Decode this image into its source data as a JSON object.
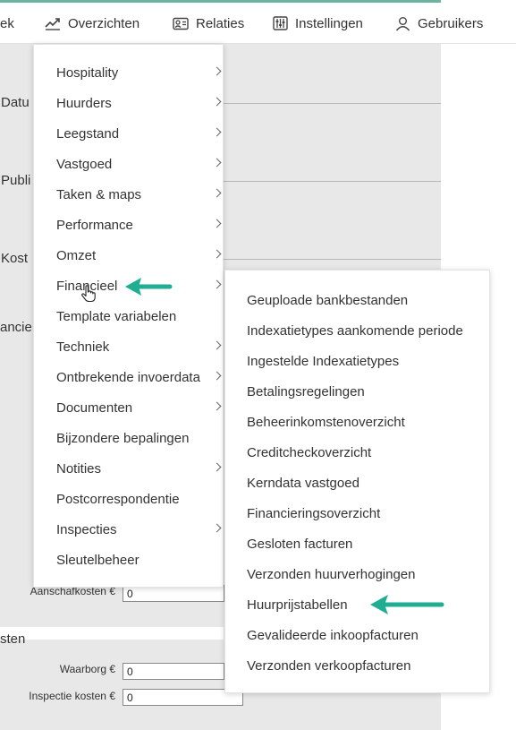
{
  "nav": {
    "items": [
      {
        "label": "ek",
        "icon": "book-icon"
      },
      {
        "label": "Overzichten",
        "icon": "trend-chart-icon"
      },
      {
        "label": "Relaties",
        "icon": "contact-card-icon"
      },
      {
        "label": "Instellingen",
        "icon": "sliders-icon"
      },
      {
        "label": "Gebruikers",
        "icon": "user-icon"
      }
    ],
    "accent_color": "#6cb4a0"
  },
  "background": {
    "labels": [
      "Datu",
      "Publi",
      "Kost",
      "ancie",
      "sten"
    ],
    "fields": [
      {
        "label": "Aanschafkosten €",
        "value": "0"
      },
      {
        "label": "Waarborg €",
        "value": "0"
      },
      {
        "label": "Inspectie kosten €",
        "value": "0"
      }
    ]
  },
  "menu": {
    "items": [
      {
        "label": "Hospitality",
        "has_submenu": true
      },
      {
        "label": "Huurders",
        "has_submenu": true
      },
      {
        "label": "Leegstand",
        "has_submenu": true
      },
      {
        "label": "Vastgoed",
        "has_submenu": true
      },
      {
        "label": "Taken & maps",
        "has_submenu": true
      },
      {
        "label": "Performance",
        "has_submenu": true
      },
      {
        "label": "Omzet",
        "has_submenu": true
      },
      {
        "label": "Financieel",
        "has_submenu": true,
        "hovered": true
      },
      {
        "label": "Template variabelen",
        "has_submenu": false
      },
      {
        "label": "Techniek",
        "has_submenu": true
      },
      {
        "label": "Ontbrekende invoerdata",
        "has_submenu": true
      },
      {
        "label": "Documenten",
        "has_submenu": true
      },
      {
        "label": "Bijzondere bepalingen",
        "has_submenu": false
      },
      {
        "label": "Notities",
        "has_submenu": true
      },
      {
        "label": "Postcorrespondentie",
        "has_submenu": false
      },
      {
        "label": "Inspecties",
        "has_submenu": true
      },
      {
        "label": "Sleutelbeheer",
        "has_submenu": false
      }
    ]
  },
  "submenu": {
    "items": [
      "Geuploade bankbestanden",
      "Indexatietypes aankomende periode",
      "Ingestelde Indexatietypes",
      "Betalingsregelingen",
      "Beheerinkomstenoverzicht",
      "Creditcheckoverzicht",
      "Kerndata vastgoed",
      "Financieringsoverzicht",
      "Gesloten facturen",
      "Verzonden huurverhogingen",
      "Huurprijstabellen",
      "Gevalideerde inkoopfacturen",
      "Verzonden verkoopfacturen"
    ]
  },
  "annotation": {
    "arrow_color": "#1fae92",
    "targets": [
      "Financieel",
      "Huurprijstabellen"
    ]
  }
}
